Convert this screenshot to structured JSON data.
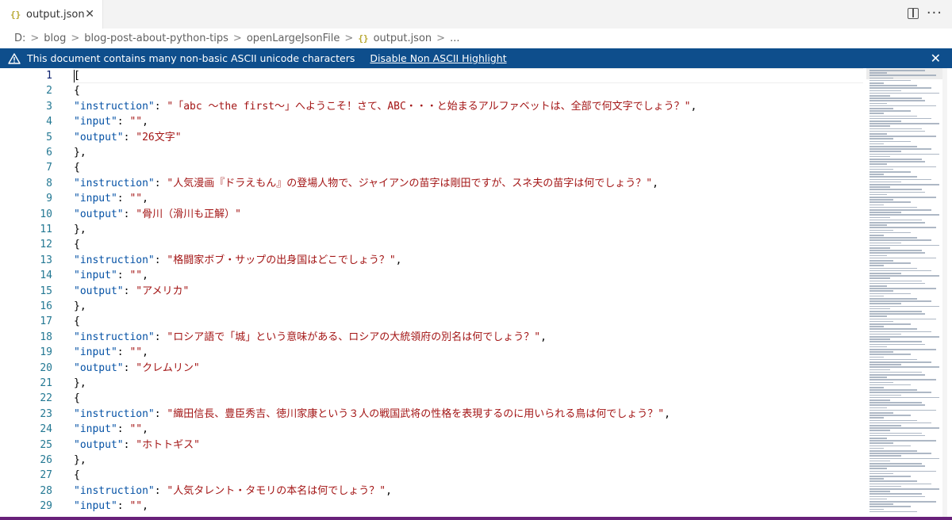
{
  "tab": {
    "icon": "{}",
    "label": "output.json",
    "close": "✕"
  },
  "breadcrumb": {
    "items": [
      "D:",
      "blog",
      "blog-post-about-python-tips",
      "openLargeJsonFile"
    ],
    "separator": ">",
    "file_icon": "{}",
    "file": "output.json",
    "tail": "..."
  },
  "banner": {
    "message": "This document contains many non-basic ASCII unicode characters",
    "link": "Disable Non ASCII Highlight",
    "close": "✕",
    "color": "#0e4e8c"
  },
  "editor": {
    "line_numbers": [
      "1",
      "2",
      "3",
      "4",
      "5",
      "6",
      "7",
      "8",
      "9",
      "10",
      "11",
      "12",
      "13",
      "14",
      "15",
      "16",
      "17",
      "18",
      "19",
      "20",
      "21",
      "22",
      "23",
      "24",
      "25",
      "26",
      "27",
      "28",
      "29"
    ],
    "lines": [
      "[",
      "{",
      "\"instruction\": \"「abc ～the first～」へようこそ！さて、ABC・・・と始まるアルファベットは、全部で何文字でしょう？\",",
      "\"input\": \"\",",
      "\"output\": \"26文字\"",
      "},",
      "{",
      "\"instruction\": \"人気漫画『ドラえもん』の登場人物で、ジャイアンの苗字は剛田ですが、スネ夫の苗字は何でしょう？\",",
      "\"input\": \"\",",
      "\"output\": \"骨川（滑川も正解）\"",
      "},",
      "{",
      "\"instruction\": \"格闘家ボブ・サップの出身国はどこでしょう？\",",
      "\"input\": \"\",",
      "\"output\": \"アメリカ\"",
      "},",
      "{",
      "\"instruction\": \"ロシア語で「城」という意味がある、ロシアの大統領府の別名は何でしょう？\",",
      "\"input\": \"\",",
      "\"output\": \"クレムリン\"",
      "},",
      "{",
      "\"instruction\": \"織田信長、豊臣秀吉、徳川家康という３人の戦国武将の性格を表現するのに用いられる鳥は何でしょう？\",",
      "\"input\": \"\",",
      "\"output\": \"ホトトギス\"",
      "},",
      "{",
      "\"instruction\": \"人気タレント・タモリの本名は何でしょう？\",",
      "\"input\": \"\","
    ]
  },
  "colors": {
    "key": "#0451a5",
    "string": "#a31515",
    "line_number": "#237893",
    "accent": "#68217a"
  }
}
